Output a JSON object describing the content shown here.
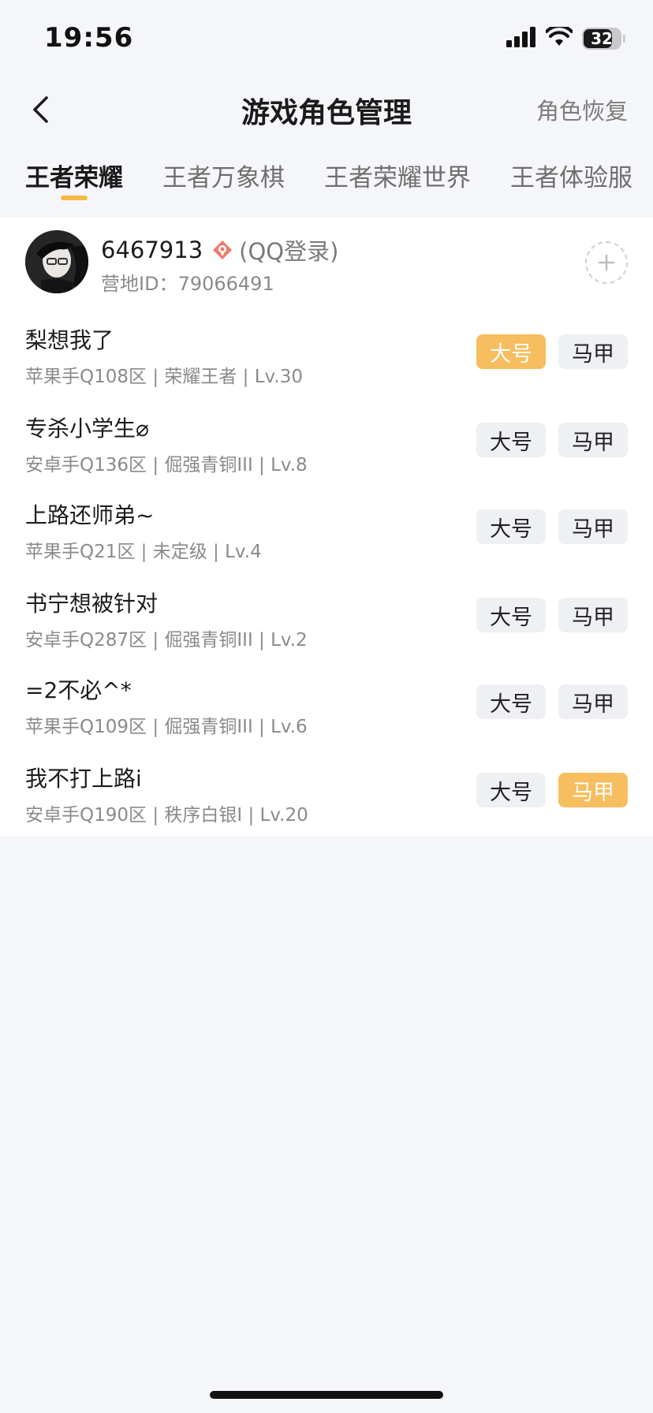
{
  "status_bar": {
    "time": "19:56",
    "battery": "32"
  },
  "nav": {
    "title": "游戏角色管理",
    "restore_label": "角色恢复"
  },
  "tabs": [
    {
      "label": "王者荣耀",
      "active": true
    },
    {
      "label": "王者万象棋",
      "active": false
    },
    {
      "label": "王者荣耀世界",
      "active": false
    },
    {
      "label": "王者体验服",
      "active": false
    }
  ],
  "account": {
    "name": "6467913",
    "login_type": "(QQ登录)",
    "camp_id_label": "营地ID：",
    "camp_id": "79066491"
  },
  "tag_labels": {
    "main": "大号",
    "alt": "马甲"
  },
  "roles": [
    {
      "name": "梨想我了",
      "info": "苹果手Q108区 | 荣耀王者 | Lv.30",
      "main_on": true,
      "alt_on": false
    },
    {
      "name": "专杀小学生⌀",
      "info": "安卓手Q136区 | 倔强青铜III | Lv.8",
      "main_on": false,
      "alt_on": false
    },
    {
      "name": "上路还师弟~",
      "info": "苹果手Q21区 | 未定级 | Lv.4",
      "main_on": false,
      "alt_on": false
    },
    {
      "name": "书宁想被针对",
      "info": "安卓手Q287区 | 倔强青铜III | Lv.2",
      "main_on": false,
      "alt_on": false
    },
    {
      "name": "=2不必^*",
      "info": "苹果手Q109区 | 倔强青铜III | Lv.6",
      "main_on": false,
      "alt_on": false
    },
    {
      "name": "我不打上路i",
      "info": "安卓手Q190区 | 秩序白银I | Lv.20",
      "main_on": false,
      "alt_on": true
    }
  ],
  "colors": {
    "accent": "#f6be5e",
    "tag_off": "#eef0f4",
    "background": "#f5f6f9"
  },
  "icons": {
    "back": "chevron-left-icon",
    "qq": "qq-icon",
    "add": "plus-icon"
  }
}
